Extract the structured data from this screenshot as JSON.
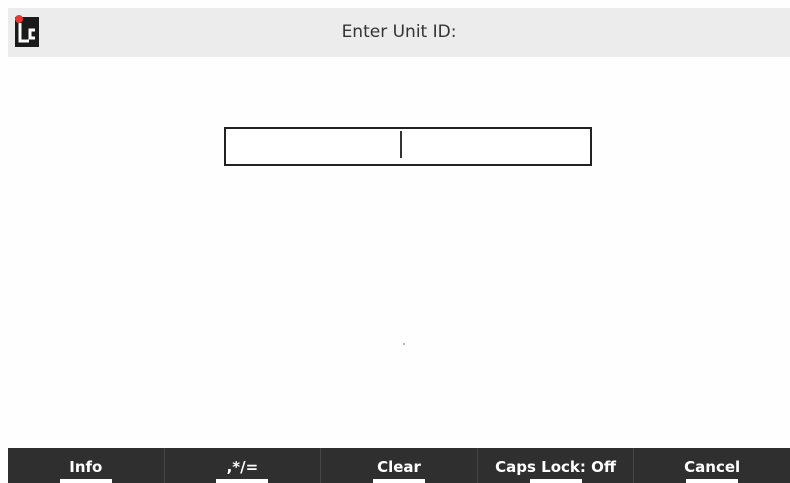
{
  "header": {
    "title": "Enter Unit ID:",
    "logo_icon": "lc-logo-icon",
    "logo_colors": {
      "block": "#1a1a1a",
      "dot": "#e53935"
    }
  },
  "unit_id_input": {
    "value": ""
  },
  "softkeys": [
    {
      "label": "Info"
    },
    {
      "label": ",*/="
    },
    {
      "label": "Clear"
    },
    {
      "label": "Caps Lock: Off"
    },
    {
      "label": "Cancel"
    }
  ],
  "colors": {
    "title_bar": "#ececec",
    "softkey_bar": "#2f2f2f"
  }
}
